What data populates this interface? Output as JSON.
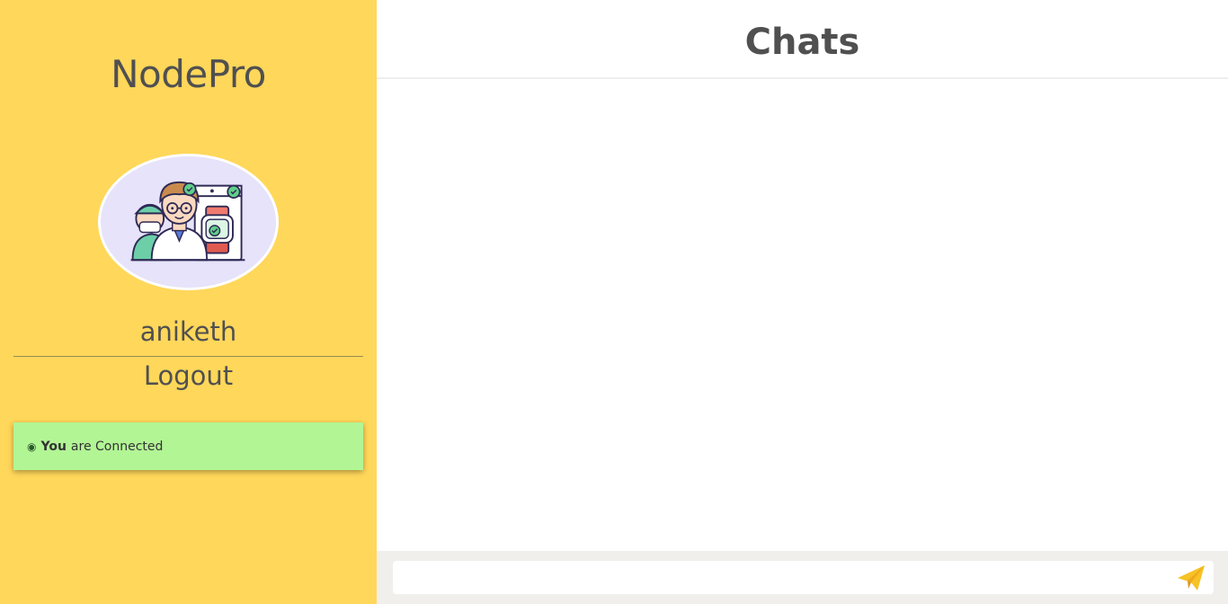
{
  "sidebar": {
    "brand": "NodePro",
    "avatar_icon": "doctor-team-illustration-icon",
    "username": "aniketh",
    "logout_label": "Logout",
    "status": {
      "dot": "◉",
      "you": "You",
      "text": "are Connected"
    }
  },
  "main": {
    "title": "Chats",
    "composer": {
      "input_value": "",
      "send_icon": "paper-plane-icon"
    }
  },
  "colors": {
    "sidebar_bg": "#ffd75a",
    "status_bg": "#b2f595",
    "send_icon": "#f6c225",
    "composer_bg": "#f1efec"
  }
}
